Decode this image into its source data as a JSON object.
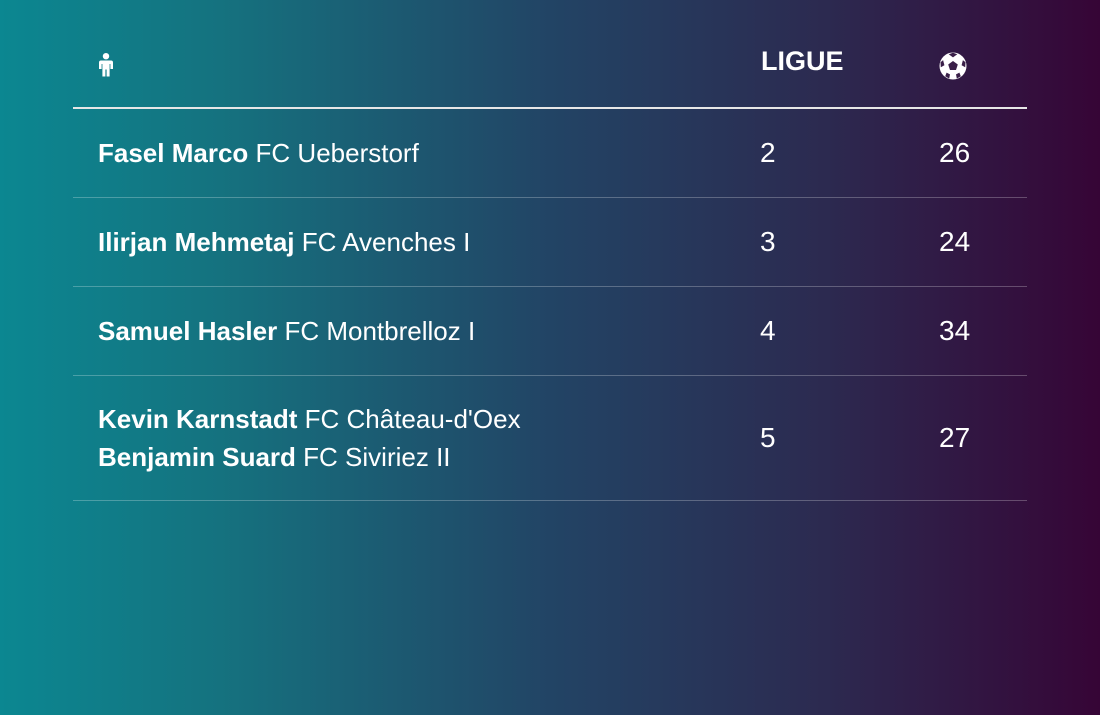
{
  "table": {
    "header": {
      "player_icon": "person-icon",
      "league_label": "LIGUE",
      "goals_icon": "soccer-ball-icon"
    },
    "rows": [
      {
        "players": [
          {
            "name": "Fasel Marco",
            "club": "FC Ueberstorf"
          }
        ],
        "league": "2",
        "goals": "26"
      },
      {
        "players": [
          {
            "name": "Ilirjan Mehmetaj",
            "club": "FC Avenches I"
          }
        ],
        "league": "3",
        "goals": "24"
      },
      {
        "players": [
          {
            "name": "Samuel Hasler",
            "club": "FC Montbrelloz I"
          }
        ],
        "league": "4",
        "goals": "34"
      },
      {
        "players": [
          {
            "name": "Kevin Karnstadt",
            "club": "FC Château-d'Oex"
          },
          {
            "name": "Benjamin Suard",
            "club": "FC Siviriez II"
          }
        ],
        "league": "5",
        "goals": "27"
      }
    ]
  },
  "colors": {
    "gradient_start": "#0b8791",
    "gradient_end": "#360536",
    "text": "#ffffff",
    "header_rule": "#e6e6e6"
  }
}
